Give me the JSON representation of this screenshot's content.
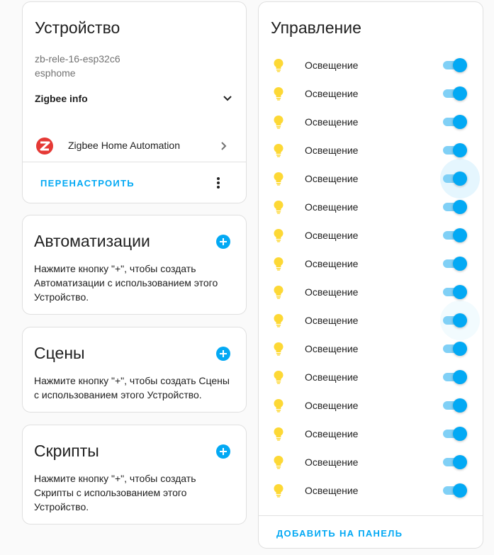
{
  "device": {
    "title": "Устройство",
    "model": "zb-rele-16-esp32c6",
    "manufacturer": "esphome",
    "zigbee_info_label": "Zigbee info",
    "integration_label": "Zigbee Home Automation",
    "reconfigure_label": "ПЕРЕНАСТРОИТЬ"
  },
  "automations": {
    "title": "Автоматизации",
    "text": "Нажмите кнопку \"+\", чтобы создать Автоматизации с использованием этого Устройство."
  },
  "scenes": {
    "title": "Сцены",
    "text": "Нажмите кнопку \"+\", чтобы создать Сцены с использованием этого Устройство."
  },
  "scripts": {
    "title": "Скрипты",
    "text": "Нажмите кнопку \"+\", чтобы создать Скрипты с использованием этого Устройство."
  },
  "controls": {
    "title": "Управление",
    "add_to_panel_label": "ДОБАВИТЬ НА ПАНЕЛЬ",
    "items": [
      {
        "label": "Освещение",
        "state": "on"
      },
      {
        "label": "Освещение",
        "state": "on"
      },
      {
        "label": "Освещение",
        "state": "on"
      },
      {
        "label": "Освещение",
        "state": "on"
      },
      {
        "label": "Освещение",
        "state": "on"
      },
      {
        "label": "Освещение",
        "state": "on"
      },
      {
        "label": "Освещение",
        "state": "on"
      },
      {
        "label": "Освещение",
        "state": "on"
      },
      {
        "label": "Освещение",
        "state": "on"
      },
      {
        "label": "Освещение",
        "state": "on"
      },
      {
        "label": "Освещение",
        "state": "on"
      },
      {
        "label": "Освещение",
        "state": "on"
      },
      {
        "label": "Освещение",
        "state": "on"
      },
      {
        "label": "Освещение",
        "state": "on"
      },
      {
        "label": "Освещение",
        "state": "on"
      },
      {
        "label": "Освещение",
        "state": "on"
      }
    ]
  },
  "icons": {
    "light": "lightbulb-icon",
    "integration": "zigbee-logo-icon",
    "expand": "chevron-down-icon",
    "navigate": "chevron-right-icon",
    "menu": "kebab-menu-icon",
    "add": "plus-circle-icon"
  },
  "colors": {
    "accent": "#03a9f4",
    "bulb": "#fdd835",
    "zigbee": "#e53935"
  }
}
